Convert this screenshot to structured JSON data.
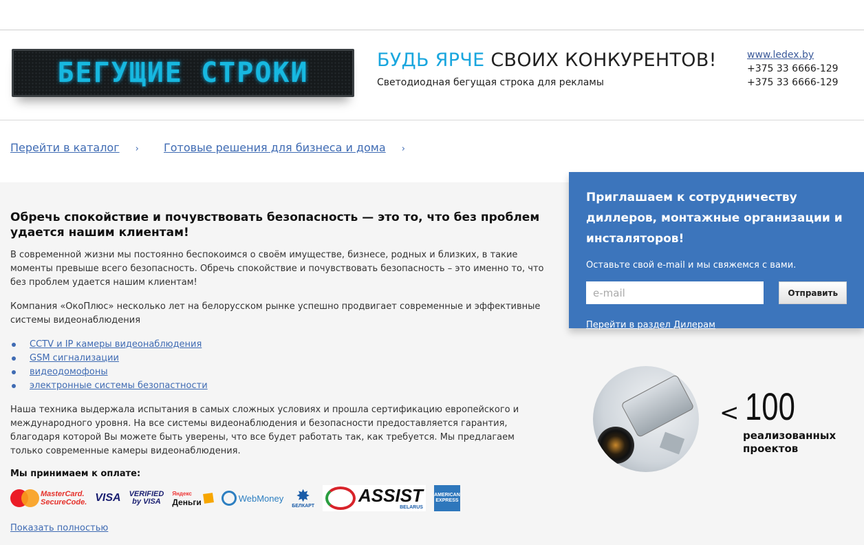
{
  "header": {
    "led_text": "БЕГУЩИЕ СТРОКИ",
    "slogan_accent": "БУДЬ ЯРЧЕ",
    "slogan_rest": " СВОИХ КОНКУРЕНТОВ!",
    "slogan_sub": "Светодиодная бегущая строка для рекламы",
    "site": "www.ledex.by",
    "phone1": "+375 33 6666-129",
    "phone2": "+375 33 6666-129"
  },
  "nav": {
    "catalog": "Перейти в каталог",
    "solutions": "Готовые решения для бизнеса и дома",
    "chevron": "›"
  },
  "main": {
    "title": "Обречь спокойствие и почувствовать безопасность — это то, что без проблем удается нашим клиентам!",
    "para1": "В современной жизни мы постоянно беспокоимся о своём имуществе, бизнесе, родных и близких, в такие моменты превыше всего безопасность. Обречь спокойствие и почувствовать безопасность – это именно то, что без проблем удается нашим клиентам!",
    "para2": "Компания «ОкоПлюс» несколько лет на белорусском рынке успешно продвигает современные и эффективные системы видеонаблюдения",
    "features": [
      "CCTV и IP камеры видеонаблюдения",
      "GSM сигнализации",
      "видеодомофоны",
      "электронные системы безопастности"
    ],
    "para3": "Наша техника выдержала испытания в самых сложных условиях и прошла сертификацию европейского и международного уровня. На все системы видеонаблюдения и безопасности предоставляется гарантия, благодаря которой Вы можете быть уверены, что все будет работать так, как требуется. Мы предлагаем только современные камеры видеонаблюдения.",
    "pay_label": "Мы принимаем к оплате:",
    "show_all": "Показать полностью"
  },
  "payments": {
    "mc_line1": "MasterCard.",
    "mc_line2": "SecureCode.",
    "visa": "VISA",
    "vbv_line1": "VERIFIED",
    "vbv_line2": "by VISA",
    "yd_small": "Яндекс",
    "yd_main": "Деньги",
    "webmoney": "WebMoney",
    "belkart": "БЕЛКАРТ",
    "assist": "ASSIST",
    "assist_sub": "BELARUS",
    "amex_line1": "AMERICAN",
    "amex_line2": "EXPRESS"
  },
  "dealer": {
    "title": "Приглашаем к сотрудничеству диллеров, монтажные организации и инсталяторов!",
    "text": "Оставьте свой e-mail и мы свяжемся с вами.",
    "email_placeholder": "e-mail",
    "email_value": "",
    "send": "Отправить",
    "link": "Перейти в раздел Дилерам"
  },
  "stat": {
    "prefix": "<",
    "value": "100",
    "label_line1": "реализованных",
    "label_line2": "проектов"
  },
  "colors": {
    "accent_blue": "#19a6de",
    "link_blue": "#3f6bb3",
    "dealer_bg": "#3c75bc",
    "content_bg": "#f5f5f5"
  }
}
